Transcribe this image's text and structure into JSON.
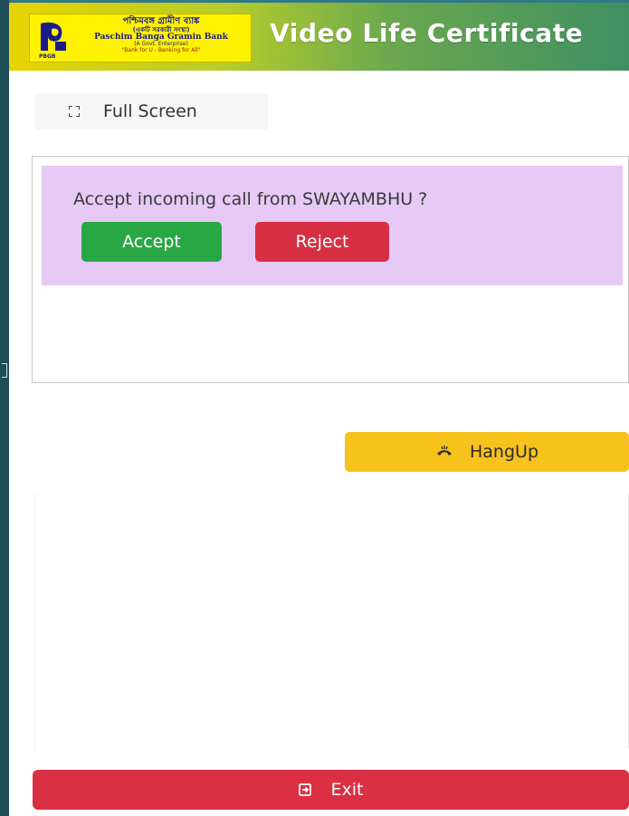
{
  "header": {
    "title": "Video Life Certificate",
    "logo": {
      "bengali_name": "পশ্চিমবঙ্গ গ্রামীণ ব্যাঙ্ক",
      "bengali_subtitle": "(একটি সরকারী সংস্থা)",
      "english_name": "Paschim Banga Gramin Bank",
      "enterprise": "(A Govt. Enterprise)",
      "tagline": "\"Bank for U - Banking for All\"",
      "mark_text": "PBGB"
    }
  },
  "toolbar": {
    "fullscreen_label": "Full Screen"
  },
  "call": {
    "prompt": "Accept incoming call from SWAYAMBHU ?",
    "accept_label": "Accept",
    "reject_label": "Reject"
  },
  "controls": {
    "hangup_label": "HangUp",
    "exit_label": "Exit"
  },
  "colors": {
    "accept": "#2aa745",
    "reject": "#d62e42",
    "hangup": "#f8c21c",
    "exit": "#db2f44",
    "alert_background": "#e6c9f5",
    "header_start": "#e8d400",
    "header_end": "#3f8f63"
  },
  "icons": {
    "fullscreen": "expand-icon",
    "hangup": "phone-hangup-icon",
    "exit": "exit-icon"
  }
}
